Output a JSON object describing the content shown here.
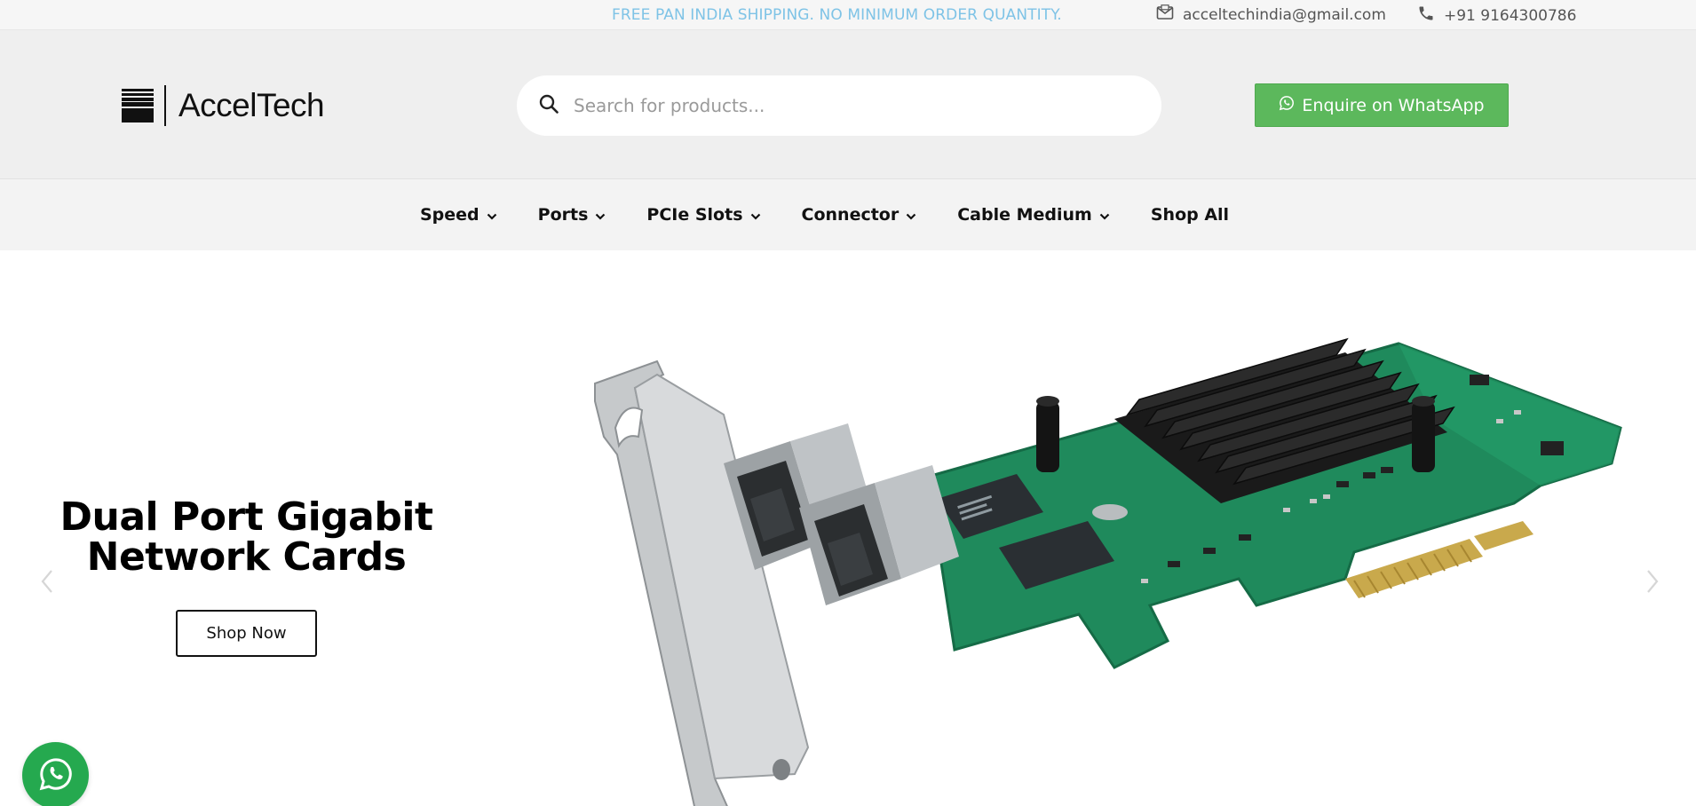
{
  "topbar": {
    "announcement": "FREE PAN INDIA SHIPPING. NO MINIMUM ORDER QUANTITY.",
    "email": "acceltechindia@gmail.com",
    "phone": "+91 9164300786",
    "announcement_color": "#7ec3e6"
  },
  "header": {
    "logo_text": "AccelTech",
    "search_placeholder": "Search for products...",
    "whatsapp_button": "Enquire on WhatsApp",
    "whatsapp_color": "#5cb85c"
  },
  "nav": {
    "items": [
      {
        "label": "Speed",
        "has_dropdown": true
      },
      {
        "label": "Ports",
        "has_dropdown": true
      },
      {
        "label": "PCIe Slots",
        "has_dropdown": true
      },
      {
        "label": "Connector",
        "has_dropdown": true
      },
      {
        "label": "Cable Medium",
        "has_dropdown": true
      },
      {
        "label": "Shop All",
        "has_dropdown": false
      }
    ]
  },
  "hero": {
    "title_line1": "Dual Port Gigabit",
    "title_line2": "Network Cards",
    "cta": "Shop Now",
    "image_subject": "dual-port-gigabit-network-card"
  },
  "icons": {
    "email": "envelope-icon",
    "phone": "phone-icon",
    "search": "search-icon",
    "whatsapp": "whatsapp-icon",
    "chevron": "chevron-down-icon",
    "prev": "chevron-left-icon",
    "next": "chevron-right-icon"
  },
  "floating_whatsapp_color": "#25a94f"
}
